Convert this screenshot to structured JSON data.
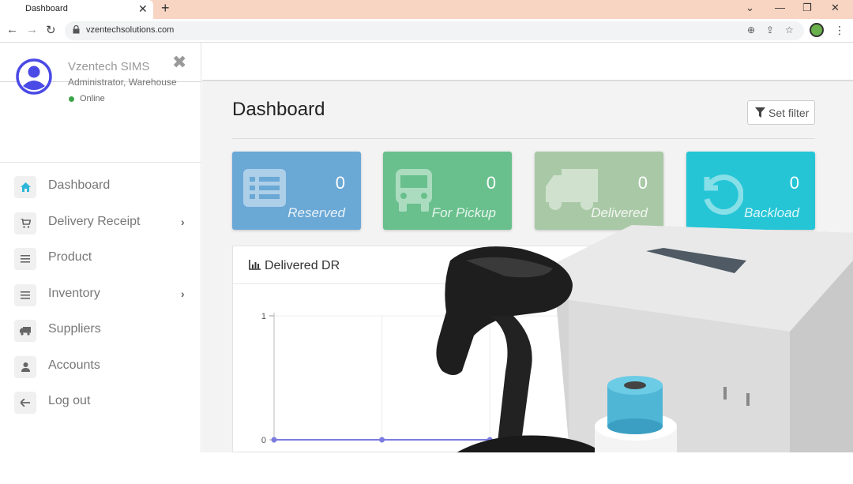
{
  "browser": {
    "tab_title": "Dashboard",
    "tab_close": "✕",
    "new_tab": "+",
    "url": "vzentechsolutions.com",
    "controls": {
      "dropdown": "⌄",
      "minimize": "—",
      "restore": "❐",
      "close": "✕"
    }
  },
  "sidebar": {
    "close_icon": "close-icon",
    "user": {
      "name": "Vzentech SIMS",
      "role": "Administrator, Warehouse",
      "status": "Online",
      "status_color": "#3ea44a"
    },
    "items": [
      {
        "label": "Dashboard",
        "icon": "home-icon",
        "active": true,
        "has_children": false
      },
      {
        "label": "Delivery Receipt",
        "icon": "cart-icon",
        "active": false,
        "has_children": true
      },
      {
        "label": "Product",
        "icon": "list-icon",
        "active": false,
        "has_children": false
      },
      {
        "label": "Inventory",
        "icon": "list-icon",
        "active": false,
        "has_children": true
      },
      {
        "label": "Suppliers",
        "icon": "truck-icon",
        "active": false,
        "has_children": false
      },
      {
        "label": "Accounts",
        "icon": "user-icon",
        "active": false,
        "has_children": false
      },
      {
        "label": "Log out",
        "icon": "arrow-left-icon",
        "active": false,
        "has_children": false
      }
    ]
  },
  "main": {
    "title": "Dashboard",
    "filter_button": "Set filter",
    "stats": [
      {
        "label": "Reserved",
        "value": "0",
        "color": "#6aa8d6",
        "icon": "list-icon"
      },
      {
        "label": "For Pickup",
        "value": "0",
        "color": "#69c08d",
        "icon": "bus-icon"
      },
      {
        "label": "Delivered",
        "value": "0",
        "color": "#a9c9a6",
        "icon": "truck-icon"
      },
      {
        "label": "Backload",
        "value": "0",
        "color": "#25c5d6",
        "icon": "undo-icon"
      }
    ],
    "panel": {
      "title": "Delivered DR",
      "icon": "bar-chart-icon"
    }
  },
  "chart_data": {
    "type": "line",
    "title": "Delivered DR",
    "y_ticks": [
      "1",
      "0"
    ],
    "ylim": [
      0,
      1
    ],
    "series": [
      {
        "values": [
          0,
          0,
          0,
          0,
          0,
          0
        ],
        "color": "#7b7be0"
      }
    ],
    "grid": true
  },
  "colors": {
    "tab_bar": "#f8d5c2",
    "active_icon": "#2eb6d8",
    "content_bg": "#f3f3f3"
  }
}
